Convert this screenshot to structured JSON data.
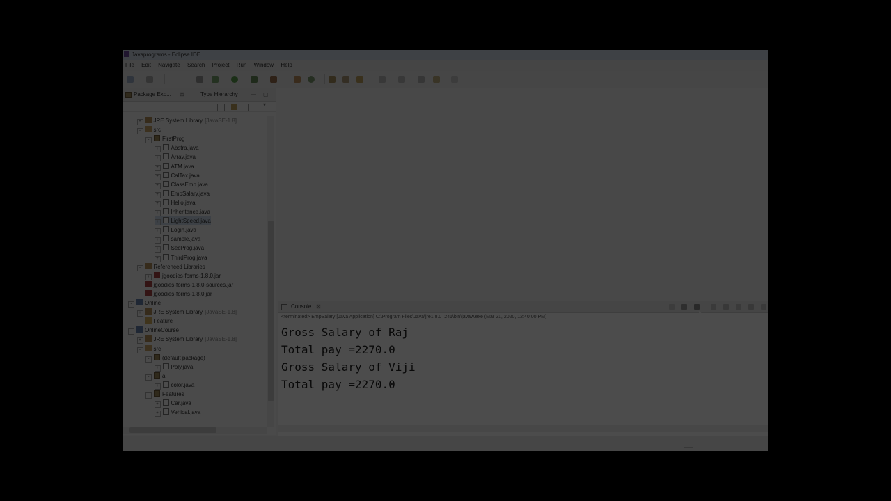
{
  "window": {
    "title": "Javaprograms - Eclipse IDE"
  },
  "menu": [
    "File",
    "Edit",
    "Navigate",
    "Search",
    "Project",
    "Run",
    "Window",
    "Help"
  ],
  "package_explorer": {
    "tabs": [
      "Package Exp...",
      "Type Hierarchy"
    ],
    "tree": [
      {
        "label": "JRE System Library",
        "suffix": "[JavaSE-1.8]",
        "depth": 1,
        "icon": "lib",
        "toggle": "+"
      },
      {
        "label": "src",
        "depth": 1,
        "icon": "src",
        "toggle": "-"
      },
      {
        "label": "FirstProg",
        "depth": 2,
        "icon": "pkg",
        "toggle": "-"
      },
      {
        "label": "Abstra.java",
        "depth": 3,
        "icon": "java",
        "toggle": "+"
      },
      {
        "label": "Array.java",
        "depth": 3,
        "icon": "java",
        "toggle": "+"
      },
      {
        "label": "ATM.java",
        "depth": 3,
        "icon": "java",
        "toggle": "+"
      },
      {
        "label": "CalTax.java",
        "depth": 3,
        "icon": "java",
        "toggle": "+"
      },
      {
        "label": "ClassEmp.java",
        "depth": 3,
        "icon": "java",
        "toggle": "+"
      },
      {
        "label": "EmpSalary.java",
        "depth": 3,
        "icon": "java",
        "toggle": "+"
      },
      {
        "label": "Hello.java",
        "depth": 3,
        "icon": "java",
        "toggle": "+"
      },
      {
        "label": "Inheritance.java",
        "depth": 3,
        "icon": "java",
        "toggle": "+"
      },
      {
        "label": "LightSpeed.java",
        "depth": 3,
        "icon": "java",
        "toggle": "+",
        "selected": true
      },
      {
        "label": "Login.java",
        "depth": 3,
        "icon": "java",
        "toggle": "+"
      },
      {
        "label": "sample.java",
        "depth": 3,
        "icon": "java",
        "toggle": "+"
      },
      {
        "label": "SecProg.java",
        "depth": 3,
        "icon": "java",
        "toggle": "+"
      },
      {
        "label": "ThirdProg.java",
        "depth": 3,
        "icon": "java",
        "toggle": "+"
      },
      {
        "label": "Referenced Libraries",
        "depth": 1,
        "icon": "lib",
        "toggle": "-"
      },
      {
        "label": "jgoodies-forms-1.8.0.jar",
        "depth": 2,
        "icon": "jar",
        "toggle": "+"
      },
      {
        "label": "jgoodies-forms-1.8.0-sources.jar",
        "depth": 1,
        "icon": "jar",
        "toggle": ""
      },
      {
        "label": "jgoodies-forms-1.8.0.jar",
        "depth": 1,
        "icon": "jar",
        "toggle": ""
      },
      {
        "label": "Online",
        "depth": 0,
        "icon": "proj",
        "toggle": "-"
      },
      {
        "label": "JRE System Library",
        "suffix": "[JavaSE-1.8]",
        "depth": 1,
        "icon": "lib",
        "toggle": "+"
      },
      {
        "label": "Feature",
        "depth": 1,
        "icon": "folder",
        "toggle": ""
      },
      {
        "label": "OnlineCourse",
        "depth": 0,
        "icon": "proj",
        "toggle": "-"
      },
      {
        "label": "JRE System Library",
        "suffix": "[JavaSE-1.8]",
        "depth": 1,
        "icon": "lib",
        "toggle": "+"
      },
      {
        "label": "src",
        "depth": 1,
        "icon": "src",
        "toggle": "-"
      },
      {
        "label": "(default package)",
        "depth": 2,
        "icon": "pkg",
        "toggle": "-"
      },
      {
        "label": "Poly.java",
        "depth": 3,
        "icon": "java",
        "toggle": "+"
      },
      {
        "label": "a",
        "depth": 2,
        "icon": "pkg",
        "toggle": "-"
      },
      {
        "label": "color.java",
        "depth": 3,
        "icon": "java",
        "toggle": "+"
      },
      {
        "label": "Features",
        "depth": 2,
        "icon": "pkg",
        "toggle": "-"
      },
      {
        "label": "Car.java",
        "depth": 3,
        "icon": "java",
        "toggle": "+"
      },
      {
        "label": "Vehical.java",
        "depth": 3,
        "icon": "java",
        "toggle": "+"
      }
    ]
  },
  "console": {
    "tab_label": "Console",
    "status": "<terminated> EmpSalary [Java Application] C:\\Program Files\\Java\\jre1.8.0_241\\bin\\javaw.exe (Mar 21, 2020, 12:40:00 PM)",
    "lines": [
      "Gross Salary of Raj",
      "Total pay =2270.0",
      "Gross Salary of Viji",
      "Total pay =2270.0"
    ]
  },
  "colors": {
    "dim_overlay": "#000000",
    "selection": "#cbd9ea",
    "title_bar": "#cfd9e6"
  }
}
